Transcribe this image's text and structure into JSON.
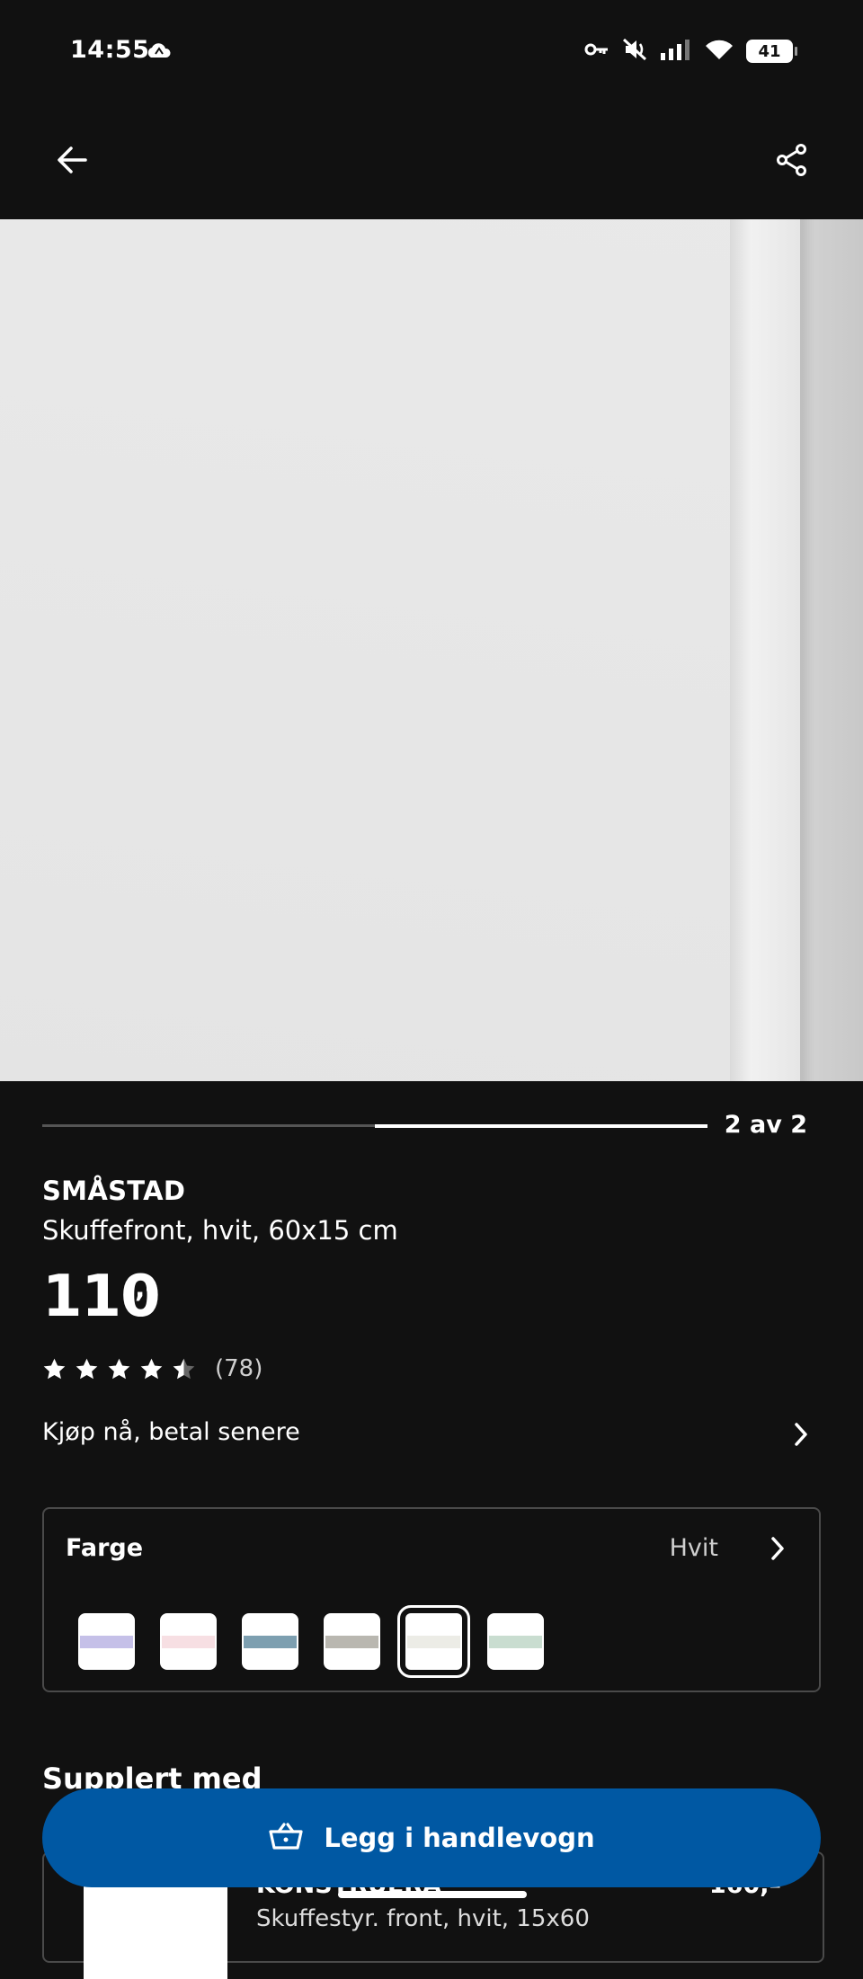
{
  "status_bar": {
    "time": "14:55",
    "battery": "41"
  },
  "top_bar": {
    "back_icon": "arrow-left-icon",
    "share_icon": "share-icon"
  },
  "gallery": {
    "page_indicator": "2 av 2",
    "current_page": 2,
    "total_pages": 2
  },
  "product": {
    "name": "SMÅSTAD",
    "description": "Skuffefront, hvit, 60x15 cm",
    "price": "110",
    "price_suffix": ",–",
    "rating": 4.5,
    "rating_count": "(78)"
  },
  "financing": {
    "label": "Kjøp nå, betal senere"
  },
  "color_selector": {
    "label": "Farge",
    "selected_value": "Hvit",
    "swatches": [
      {
        "color": "#c5c0e8",
        "selected": false
      },
      {
        "color": "#f7dfe3",
        "selected": false
      },
      {
        "color": "#7d9fb0",
        "selected": false
      },
      {
        "color": "#b9b7b0",
        "selected": false
      },
      {
        "color": "#ecece6",
        "selected": true
      },
      {
        "color": "#c9ddd0",
        "selected": false
      }
    ]
  },
  "supplement": {
    "title": "Supplert med",
    "item_name": "KONSTRUERA",
    "item_desc": "Skuffestyr. front, hvit, 15x60",
    "item_price": "160,–"
  },
  "cart": {
    "label": "Legg i handlevogn"
  },
  "colors": {
    "background": "#111111",
    "accent_blue": "#0058a3"
  }
}
